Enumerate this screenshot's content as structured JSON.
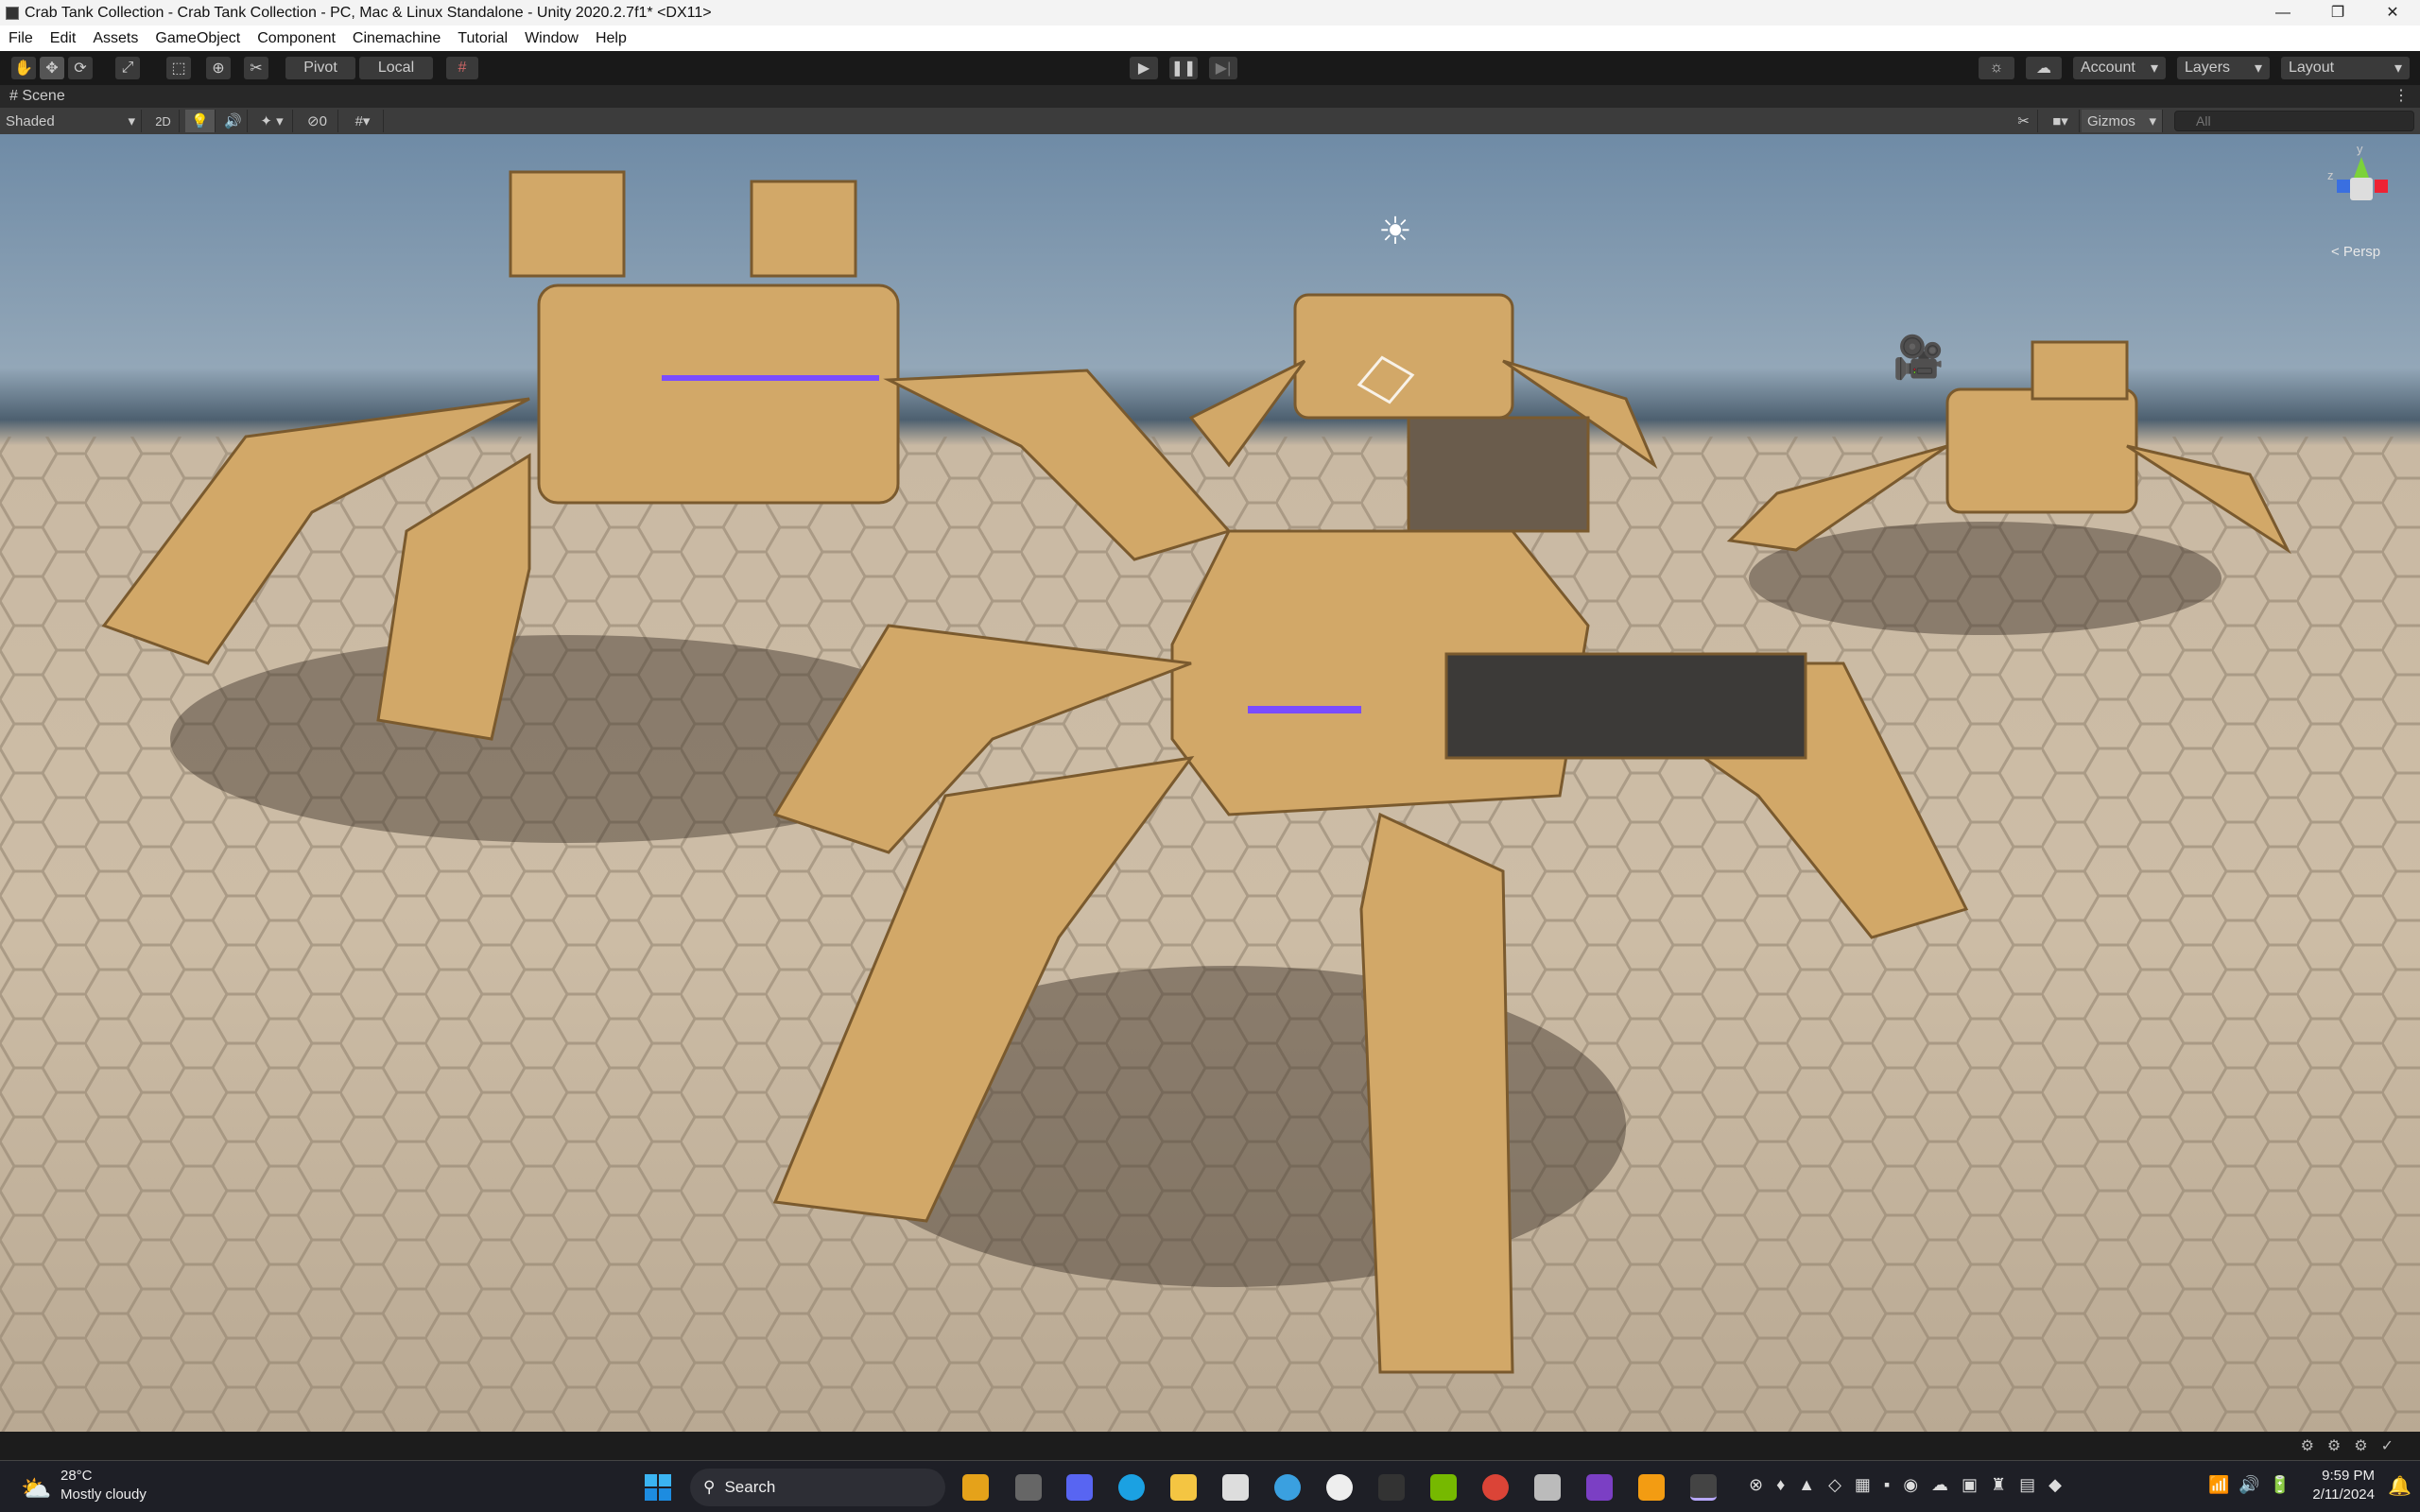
{
  "window": {
    "title": "Crab Tank Collection - Crab Tank Collection - PC, Mac & Linux Standalone - Unity 2020.2.7f1* <DX11>",
    "minimize": "—",
    "maximize": "❐",
    "close": "✕"
  },
  "menu": [
    "File",
    "Edit",
    "Assets",
    "GameObject",
    "Component",
    "Cinemachine",
    "Tutorial",
    "Window",
    "Help"
  ],
  "toolbar": {
    "pivot": "Pivot",
    "local": "Local",
    "account": "Account",
    "layers": "Layers",
    "layout": "Layout"
  },
  "scene": {
    "tab": "Scene",
    "shading": "Shaded",
    "mode_2d": "2D",
    "hidden_count": "0",
    "gizmos": "Gizmos",
    "search_placeholder": "All",
    "projection": "< Persp",
    "axis_y": "y",
    "axis_z": "z"
  },
  "taskbar": {
    "temperature": "28°C",
    "weather": "Mostly cloudy",
    "search": "Search",
    "time": "9:59 PM",
    "date": "2/11/2024"
  },
  "colors": {
    "floor": "#cdbda6",
    "crab": "#d2a868",
    "accent_purple": "#7a4cff"
  }
}
